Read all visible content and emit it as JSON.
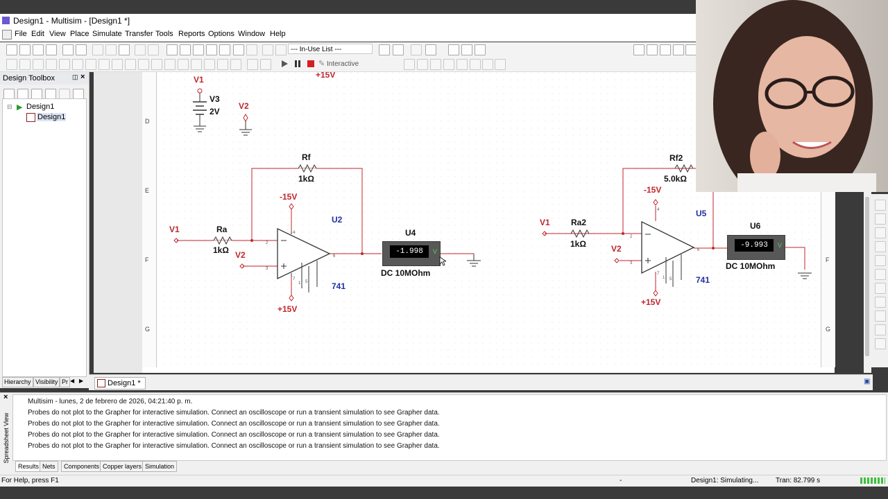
{
  "window": {
    "title": "Design1 - Multisim - [Design1 *]"
  },
  "menu": [
    "File",
    "Edit",
    "View",
    "Place",
    "Simulate",
    "Transfer",
    "Tools",
    "Reports",
    "Options",
    "Window",
    "Help"
  ],
  "toolbar": {
    "in_use_list": "--- In-Use List ---",
    "interactive_label": "Interactive"
  },
  "toolbox": {
    "title": "Design Toolbox",
    "tree_root": "Design1",
    "tree_child": "Design1",
    "tabs": [
      "Hierarchy",
      "Visibility",
      "Pr"
    ]
  },
  "document_tab": "Design1 *",
  "schematic": {
    "grid_rows": [
      "D",
      "E",
      "F",
      "G"
    ],
    "v1_label": "V1",
    "v3_label": "V3",
    "v3_value": "2V",
    "v2_label": "V2",
    "top_partial": "+15V",
    "circuit1": {
      "rf_name": "Rf",
      "rf_value": "1kΩ",
      "ra_name": "Ra",
      "ra_value": "1kΩ",
      "in1": "V1",
      "in2": "V2",
      "neg_supply": "-15V",
      "pos_supply": "+15V",
      "opamp_ref": "U2",
      "opamp_model": "741",
      "pin2": "2",
      "pin3": "3",
      "pin6": "6",
      "pin4": "4",
      "pin7": "7",
      "pin1": "1",
      "pin5": "5",
      "meter_ref": "U4",
      "meter_reading": "-1.998",
      "meter_unit": "V",
      "meter_desc": "DC  10MOhm"
    },
    "circuit2": {
      "rf_name": "Rf2",
      "rf_value": "5.0kΩ",
      "ra_name": "Ra2",
      "ra_value": "1kΩ",
      "in1": "V1",
      "in2": "V2",
      "neg_supply": "-15V",
      "pos_supply": "+15V",
      "opamp_ref": "U5",
      "opamp_model": "741",
      "pin2": "2",
      "pin3": "3",
      "pin6": "6",
      "pin4": "4",
      "pin7": "7",
      "pin1": "1",
      "pin5": "5",
      "meter_ref": "U6",
      "meter_reading": "-9.993",
      "meter_unit": "V",
      "meter_desc": "DC  10MOhm"
    }
  },
  "spreadsheet": {
    "side_label": "Spreadsheet View",
    "log": [
      "Multisim  -  lunes, 2 de febrero de 2026, 04:21:40 p. m.",
      "Probes do not plot to the Grapher for interactive simulation. Connect an oscilloscope or run a transient simulation to see Grapher data.",
      "Probes do not plot to the Grapher for interactive simulation. Connect an oscilloscope or run a transient simulation to see Grapher data.",
      "Probes do not plot to the Grapher for interactive simulation. Connect an oscilloscope or run a transient simulation to see Grapher data.",
      "Probes do not plot to the Grapher for interactive simulation. Connect an oscilloscope or run a transient simulation to see Grapher data."
    ],
    "tabs": [
      "Results",
      "Nets",
      "Components",
      "Copper layers",
      "Simulation"
    ]
  },
  "status": {
    "help": "For Help, press F1",
    "dash": "-",
    "sim_state": "Design1: Simulating...",
    "tran": "Tran: 82.799 s"
  },
  "colors": {
    "wire": "#c0262c",
    "label_blue": "#1f2f9f",
    "meter_bg": "#585858"
  }
}
